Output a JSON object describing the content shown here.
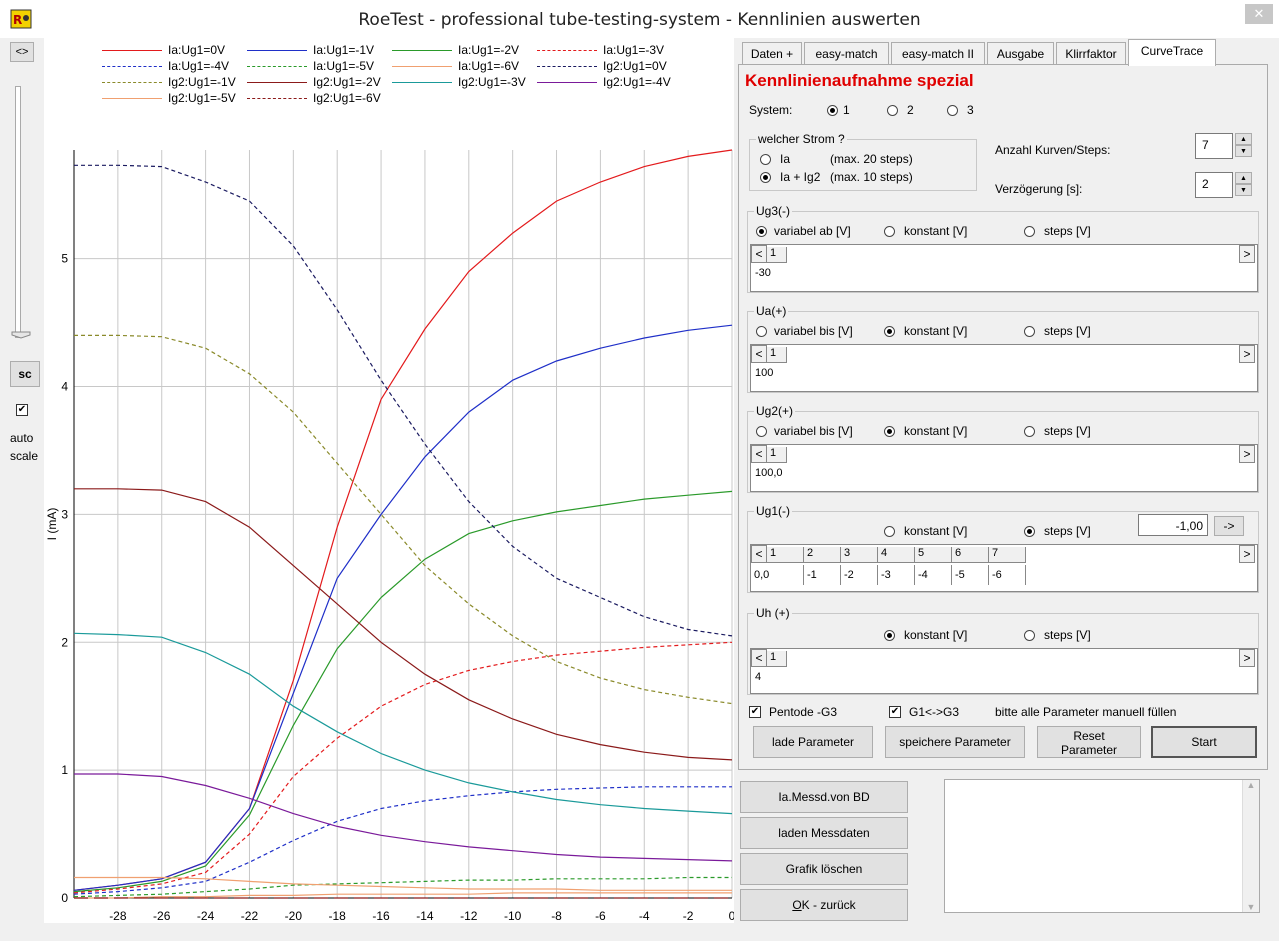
{
  "window": {
    "title": "RoeTest - professional tube-testing-system - Kennlinien auswerten",
    "close_label": "✕"
  },
  "left": {
    "toggle_label": "<>",
    "sc_label": "sc",
    "autoscale_checked": "✔",
    "autoscale_label_1": "auto",
    "autoscale_label_2": "scale"
  },
  "legend": [
    {
      "label": "Ia:Ug1=0V",
      "color": "#e31a1c",
      "dash": "solid"
    },
    {
      "label": "Ia:Ug1=-1V",
      "color": "#1f2fc8",
      "dash": "solid"
    },
    {
      "label": "Ia:Ug1=-2V",
      "color": "#2a9a2a",
      "dash": "solid"
    },
    {
      "label": "Ia:Ug1=-3V",
      "color": "#e31a1c",
      "dash": "dash"
    },
    {
      "label": "Ia:Ug1=-4V",
      "color": "#1f2fc8",
      "dash": "dash"
    },
    {
      "label": "Ia:Ug1=-5V",
      "color": "#2a9a2a",
      "dash": "dash"
    },
    {
      "label": "Ia:Ug1=-6V",
      "color": "#f0a070",
      "dash": "solid"
    },
    {
      "label": "Ig2:Ug1=0V",
      "color": "#1a1a60",
      "dash": "dash"
    },
    {
      "label": "Ig2:Ug1=-1V",
      "color": "#8a8a2a",
      "dash": "dash"
    },
    {
      "label": "Ig2:Ug1=-2V",
      "color": "#8b1a1a",
      "dash": "solid"
    },
    {
      "label": "Ig2:Ug1=-3V",
      "color": "#1a9a9a",
      "dash": "solid"
    },
    {
      "label": "Ig2:Ug1=-4V",
      "color": "#7a1a9a",
      "dash": "solid"
    },
    {
      "label": "Ig2:Ug1=-5V",
      "color": "#f0a070",
      "dash": "solid"
    },
    {
      "label": "Ig2:Ug1=-6V",
      "color": "#8b1a1a",
      "dash": "longdash"
    }
  ],
  "chart_data": {
    "type": "line",
    "ylabel": "I (mA)",
    "xlim": [
      -30,
      0
    ],
    "ylim": [
      0,
      5.85
    ],
    "xticks": [
      -28,
      -26,
      -24,
      -22,
      -20,
      -18,
      -16,
      -14,
      -12,
      -10,
      -8,
      -6,
      -4,
      -2,
      0
    ],
    "yticks": [
      0,
      1,
      2,
      3,
      4,
      5
    ],
    "grid": true,
    "x": [
      -30,
      -28,
      -26,
      -24,
      -22,
      -20,
      -18,
      -16,
      -14,
      -12,
      -10,
      -8,
      -6,
      -4,
      -2,
      0
    ],
    "series": [
      {
        "name": "Ia:Ug1=0V",
        "values": [
          0.06,
          0.1,
          0.15,
          0.28,
          0.7,
          1.7,
          2.9,
          3.9,
          4.45,
          4.9,
          5.2,
          5.45,
          5.6,
          5.72,
          5.8,
          5.85
        ]
      },
      {
        "name": "Ia:Ug1=-1V",
        "values": [
          0.06,
          0.1,
          0.15,
          0.28,
          0.7,
          1.6,
          2.5,
          3.0,
          3.45,
          3.8,
          4.05,
          4.2,
          4.3,
          4.38,
          4.44,
          4.48
        ]
      },
      {
        "name": "Ia:Ug1=-2V",
        "values": [
          0.05,
          0.08,
          0.13,
          0.25,
          0.65,
          1.35,
          1.95,
          2.35,
          2.65,
          2.85,
          2.95,
          3.02,
          3.07,
          3.12,
          3.15,
          3.18
        ]
      },
      {
        "name": "Ia:Ug1=-3V",
        "values": [
          0.04,
          0.07,
          0.11,
          0.2,
          0.5,
          0.95,
          1.25,
          1.5,
          1.67,
          1.78,
          1.85,
          1.9,
          1.93,
          1.96,
          1.98,
          2.0
        ]
      },
      {
        "name": "Ia:Ug1=-4V",
        "values": [
          0.03,
          0.05,
          0.08,
          0.13,
          0.28,
          0.45,
          0.6,
          0.7,
          0.76,
          0.8,
          0.83,
          0.85,
          0.86,
          0.87,
          0.87,
          0.87
        ]
      },
      {
        "name": "Ia:Ug1=-5V",
        "values": [
          0.01,
          0.02,
          0.03,
          0.05,
          0.07,
          0.1,
          0.11,
          0.12,
          0.13,
          0.14,
          0.14,
          0.15,
          0.15,
          0.15,
          0.16,
          0.16
        ]
      },
      {
        "name": "Ia:Ug1=-6V",
        "values": [
          0.0,
          0.0,
          0.01,
          0.01,
          0.02,
          0.02,
          0.03,
          0.03,
          0.03,
          0.03,
          0.04,
          0.04,
          0.04,
          0.04,
          0.04,
          0.04
        ]
      },
      {
        "name": "Ig2:Ug1=0V",
        "values": [
          5.73,
          5.73,
          5.72,
          5.6,
          5.45,
          5.1,
          4.6,
          4.05,
          3.55,
          3.1,
          2.75,
          2.5,
          2.35,
          2.2,
          2.1,
          2.05
        ]
      },
      {
        "name": "Ig2:Ug1=-1V",
        "values": [
          4.4,
          4.4,
          4.39,
          4.3,
          4.1,
          3.8,
          3.4,
          3.0,
          2.6,
          2.3,
          2.05,
          1.85,
          1.72,
          1.63,
          1.57,
          1.52
        ]
      },
      {
        "name": "Ig2:Ug1=-2V",
        "values": [
          3.2,
          3.2,
          3.19,
          3.1,
          2.9,
          2.6,
          2.3,
          2.0,
          1.75,
          1.55,
          1.4,
          1.28,
          1.2,
          1.14,
          1.1,
          1.08
        ]
      },
      {
        "name": "Ig2:Ug1=-3V",
        "values": [
          2.07,
          2.06,
          2.04,
          1.92,
          1.75,
          1.5,
          1.3,
          1.13,
          1.0,
          0.9,
          0.83,
          0.77,
          0.73,
          0.7,
          0.68,
          0.66
        ]
      },
      {
        "name": "Ig2:Ug1=-4V",
        "values": [
          0.97,
          0.97,
          0.95,
          0.88,
          0.78,
          0.66,
          0.56,
          0.49,
          0.44,
          0.4,
          0.37,
          0.34,
          0.32,
          0.31,
          0.3,
          0.29
        ]
      },
      {
        "name": "Ig2:Ug1=-5V",
        "values": [
          0.16,
          0.16,
          0.16,
          0.15,
          0.13,
          0.11,
          0.1,
          0.09,
          0.08,
          0.07,
          0.07,
          0.07,
          0.06,
          0.06,
          0.06,
          0.06
        ]
      },
      {
        "name": "Ig2:Ug1=-6V",
        "values": [
          0.0,
          0.0,
          0.0,
          0.0,
          0.0,
          0.0,
          0.0,
          0.0,
          0.0,
          0.0,
          0.0,
          0.0,
          0.0,
          0.0,
          0.0,
          0.0
        ]
      }
    ]
  },
  "tabs": [
    {
      "label": "Daten +",
      "active": false
    },
    {
      "label": "easy-match",
      "active": false
    },
    {
      "label": "easy-match II",
      "active": false
    },
    {
      "label": "Ausgabe",
      "active": false
    },
    {
      "label": "Klirrfaktor",
      "active": false
    },
    {
      "label": "CurveTrace",
      "active": true
    }
  ],
  "curvetrace": {
    "heading": "Kennlinienaufnahme spezial",
    "system_label": "System:",
    "system_options": [
      "1",
      "2",
      "3"
    ],
    "strom_title": "welcher Strom ?",
    "strom_opt1_a": "Ia",
    "strom_opt1_b": "(max. 20 steps)",
    "strom_opt2_a": "Ia + Ig2",
    "strom_opt2_b": "(max. 10 steps)",
    "kurven_label": "Anzahl Kurven/Steps:",
    "kurven_value": "7",
    "verz_label": "Verzögerung [s]:",
    "verz_value": "2",
    "ug3": {
      "title": "Ug3(-)",
      "opt1": "variabel ab [V]",
      "opt2": "konstant [V]",
      "opt3": "steps [V]",
      "col": "1",
      "val": "-30"
    },
    "ua": {
      "title": "Ua(+)",
      "opt1": "variabel bis [V]",
      "opt2": "konstant [V]",
      "opt3": "steps [V]",
      "col": "1",
      "val": "100"
    },
    "ug2": {
      "title": "Ug2(+)",
      "opt1": "variabel bis [V]",
      "opt2": "konstant [V]",
      "opt3": "steps [V]",
      "col": "1",
      "val": "100,0"
    },
    "ug1": {
      "title": "Ug1(-)",
      "opt2": "konstant [V]",
      "opt3": "steps [V]",
      "input": "-1,00",
      "go": "->",
      "cols": [
        "1",
        "2",
        "3",
        "4",
        "5",
        "6",
        "7"
      ],
      "vals": [
        "0,0",
        "-1",
        "-2",
        "-3",
        "-4",
        "-5",
        "-6"
      ]
    },
    "uh": {
      "title": "Uh (+)",
      "opt2": "konstant [V]",
      "opt3": "steps [V]",
      "col": "1",
      "val": "4"
    },
    "pentode_label": "Pentode -G3",
    "g1g3_label": "G1<->G3",
    "hint": "bitte alle Parameter manuell füllen",
    "btn_lade": "lade Parameter",
    "btn_speichere": "speichere Parameter",
    "btn_reset_1": "Reset",
    "btn_reset_2": "Parameter",
    "btn_start": "Start",
    "nav_left": "<",
    "nav_right": ">"
  },
  "bottom": {
    "btn1": "Ia.Messd.von BD",
    "btn2": "laden Messdaten",
    "btn3": "Grafik löschen",
    "btn4_ul": "O",
    "btn4_rest": "K - zurück"
  }
}
